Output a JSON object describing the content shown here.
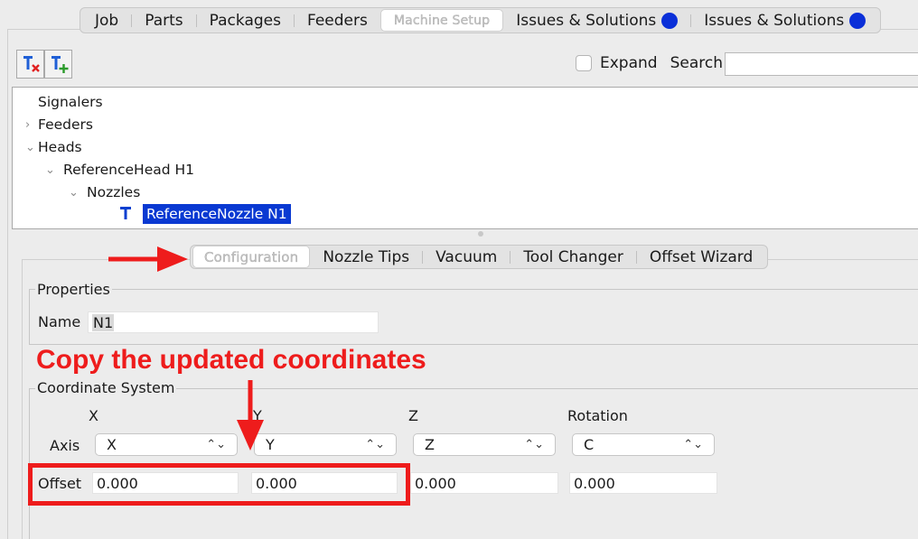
{
  "top_tabs": [
    "Job",
    "Parts",
    "Packages",
    "Feeders",
    "Machine Setup",
    "Issues & Solutions",
    "Issues & Solutions"
  ],
  "toolbar": {
    "expand_label": "Expand",
    "search_label": "Search",
    "search_value": ""
  },
  "tree": {
    "items": [
      "Signalers",
      "Feeders",
      "Heads",
      "ReferenceHead H1",
      "Nozzles",
      "ReferenceNozzle N1"
    ]
  },
  "sub_tabs": [
    "Configuration",
    "Nozzle Tips",
    "Vacuum",
    "Tool Changer",
    "Offset Wizard"
  ],
  "properties": {
    "title": "Properties",
    "name_label": "Name",
    "name_value": "N1"
  },
  "coordinate_system": {
    "title": "Coordinate System",
    "columns": [
      "X",
      "Y",
      "Z",
      "Rotation"
    ],
    "axis_label": "Axis",
    "axis_values": [
      "X",
      "Y",
      "Z",
      "C"
    ],
    "offset_label": "Offset",
    "offset_values": [
      "0.000",
      "0.000",
      "0.000",
      "0.000"
    ]
  },
  "annotation": {
    "text": "Copy the updated coordinates",
    "color": "#ee1c1c"
  },
  "colors": {
    "accent": "#0a39d2",
    "issue_dot": "#0a2fd8"
  }
}
